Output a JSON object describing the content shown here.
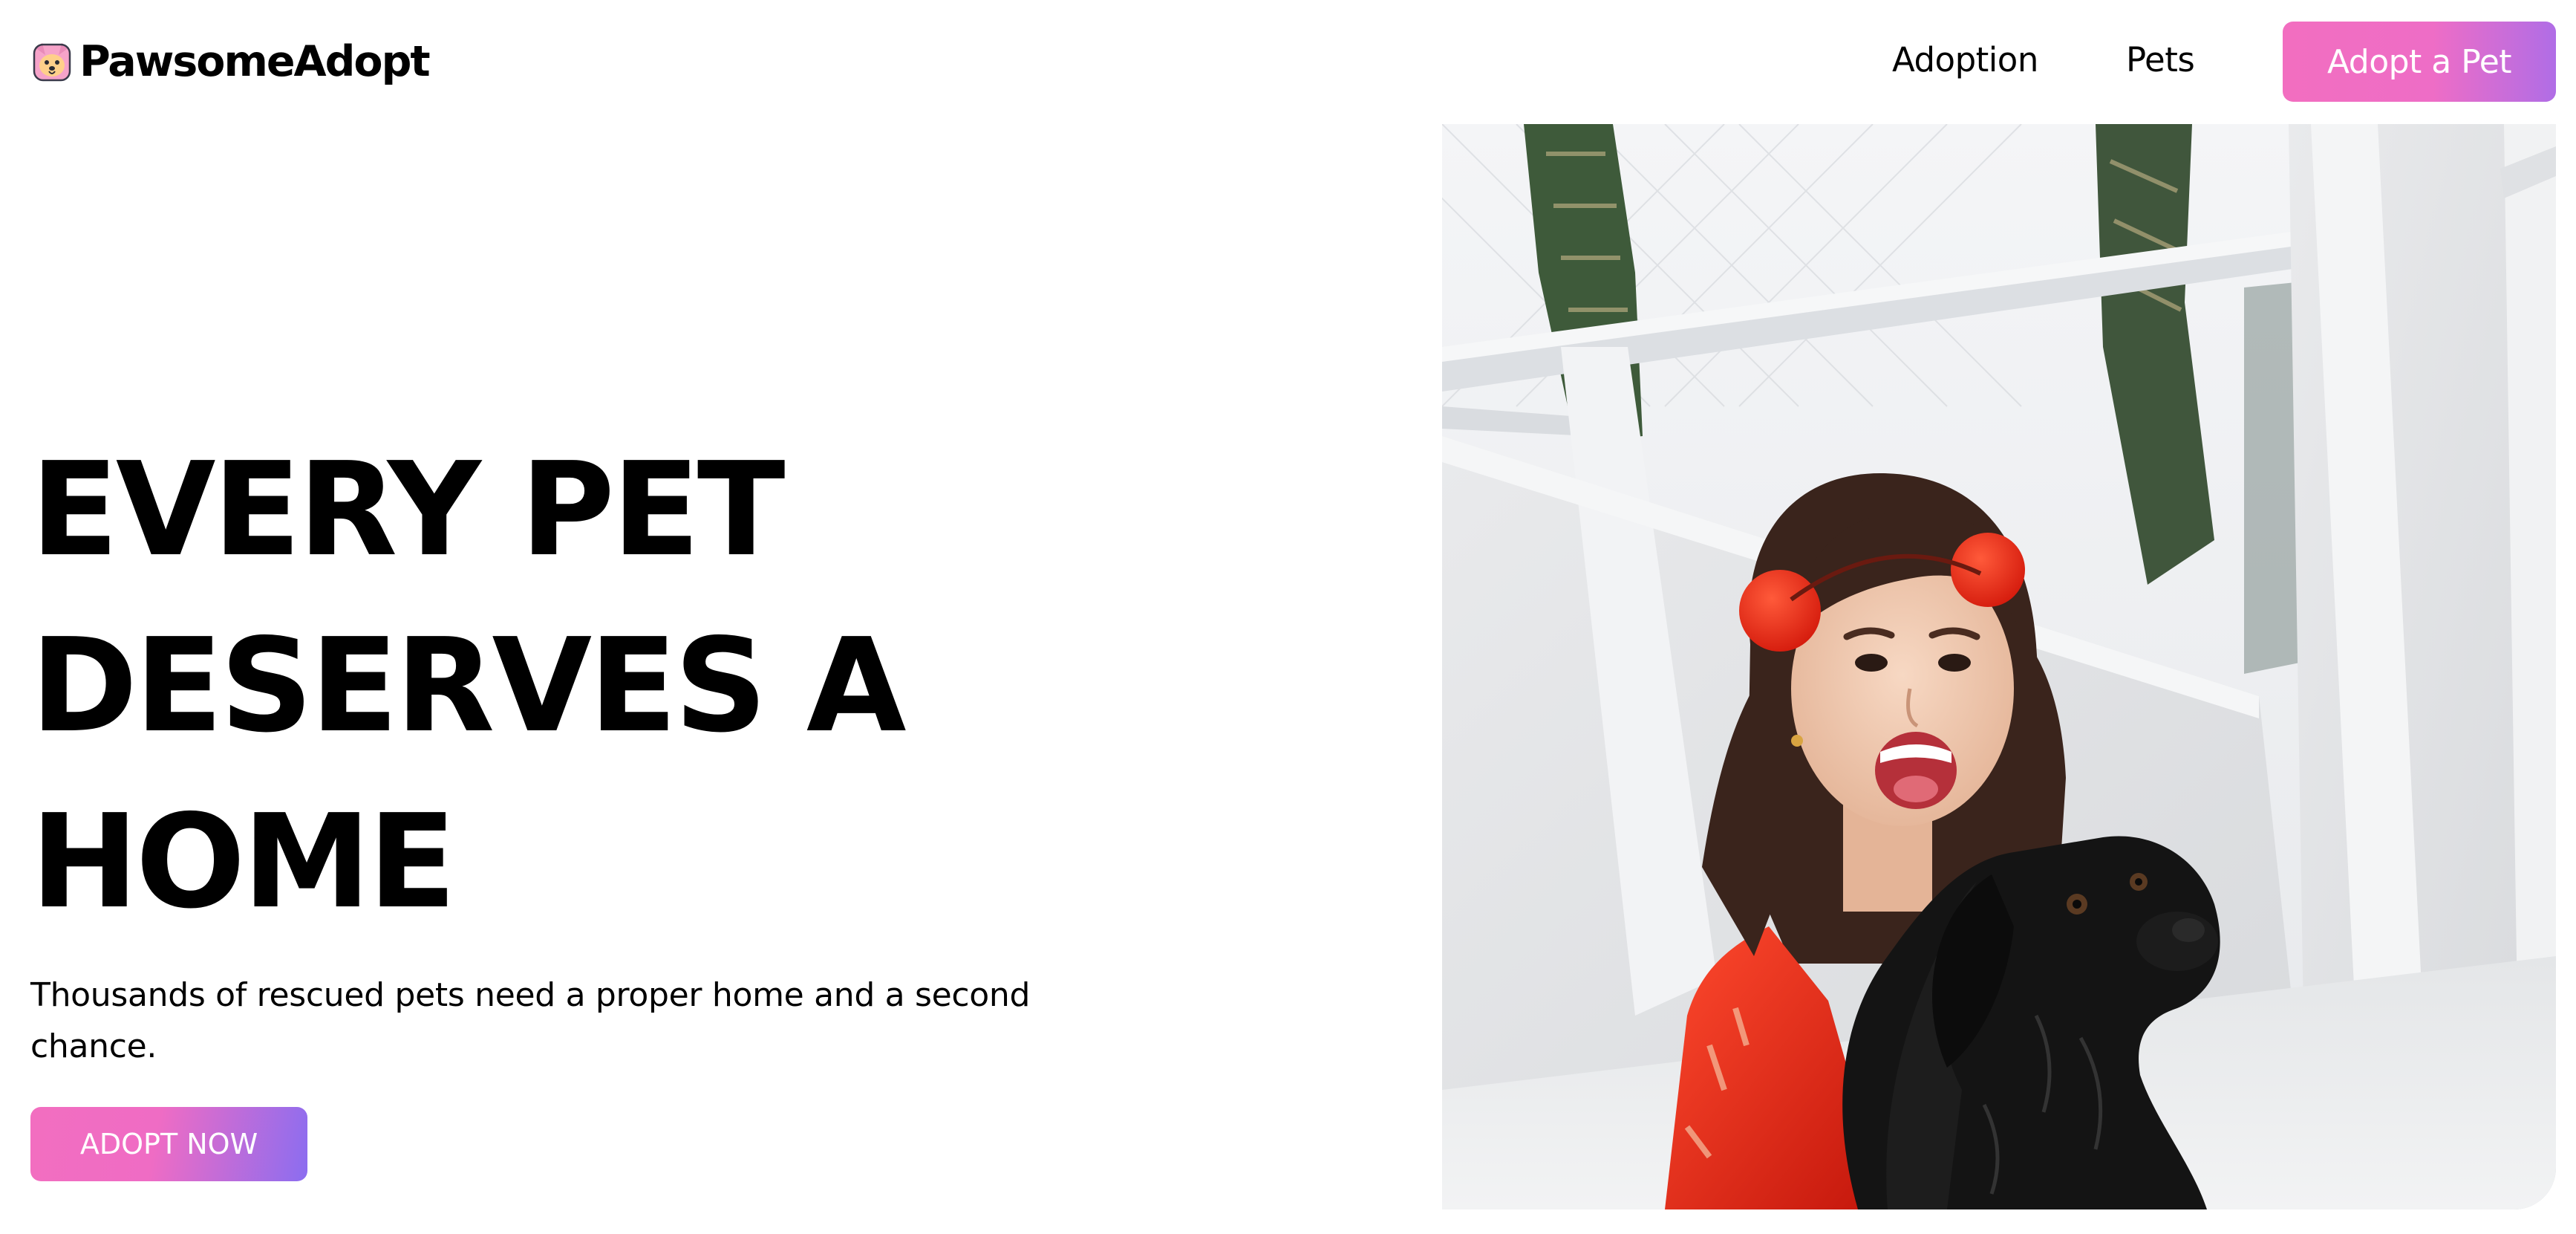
{
  "header": {
    "brand": "PawsomeAdopt",
    "logo_icon": "dog-face-icon",
    "nav": [
      {
        "label": "Adoption"
      },
      {
        "label": "Pets"
      }
    ],
    "cta_label": "Adopt a Pet"
  },
  "hero": {
    "title_lines": [
      "EVERY PET",
      "DESERVES A",
      "HOME"
    ],
    "subtitle": "Thousands of rescued pets need a proper home and a second chance.",
    "cta_label": "ADOPT NOW",
    "image_alt": "Smiling girl with red pom-pom headband hugging a black dog"
  },
  "colors": {
    "accent_pink": "#f26ec0",
    "accent_purple": "#8b6df0",
    "text": "#000000",
    "background": "#ffffff"
  }
}
